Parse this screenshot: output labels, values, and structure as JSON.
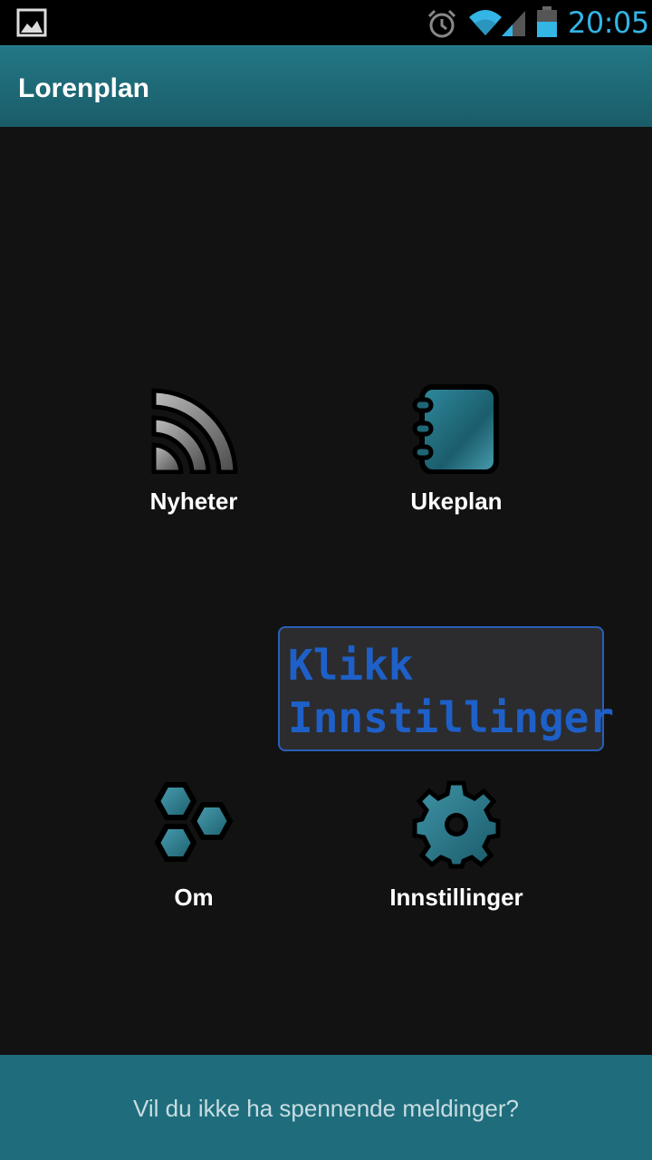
{
  "status_bar": {
    "time": "20:05",
    "icons": [
      "gallery-icon",
      "alarm-icon",
      "wifi-icon",
      "signal-icon",
      "battery-icon"
    ],
    "accent_color": "#33b5e5"
  },
  "action_bar": {
    "title": "Lorenplan",
    "background": "#1f6d7c"
  },
  "menu": {
    "items": [
      {
        "label": "Nyheter",
        "icon": "rss-icon"
      },
      {
        "label": "Ukeplan",
        "icon": "notebook-icon"
      },
      {
        "label": "Om",
        "icon": "hexagons-icon"
      },
      {
        "label": "Innstillinger",
        "icon": "gear-icon"
      }
    ]
  },
  "tooltip": {
    "line1": "Klikk",
    "line2": "Innstillinger",
    "color": "#1e60c8"
  },
  "banner": {
    "text": "Vil du ikke ha spennende meldinger?"
  }
}
